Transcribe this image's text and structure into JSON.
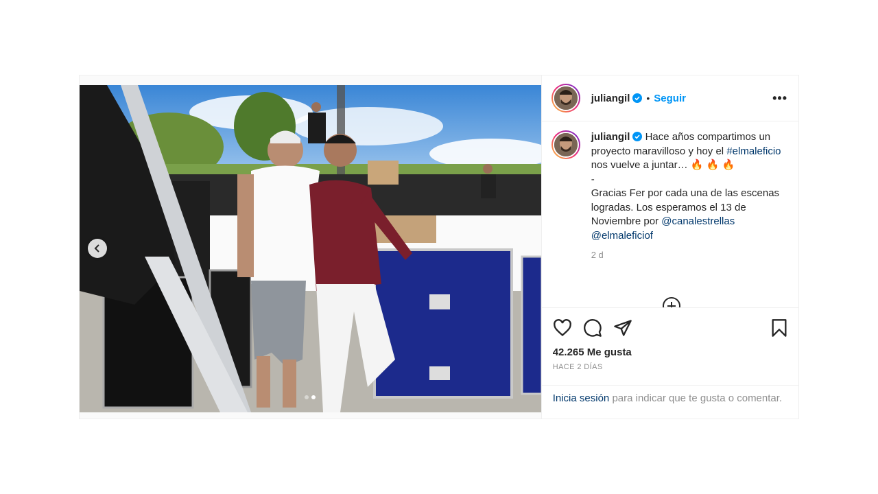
{
  "post": {
    "author": {
      "username": "juliangil",
      "verified": true
    },
    "follow_label": "Seguir",
    "more_label": "•••",
    "caption": {
      "username": "juliangil",
      "text_1": "Hace años compartimos un proyecto maravilloso y hoy el",
      "hashtag": "#elmaleficio",
      "text_2": "nos vuelve a juntar… 🔥 🔥 🔥",
      "dash": "-",
      "text_3": "Gracias Fer por cada una de las escenas logradas. Los esperamos el 13 de Noviembre por",
      "mention_1": "@canalestrellas",
      "mention_2": "@elmaleficiof"
    },
    "time": "2 d",
    "likes": "42.265 Me gusta",
    "posted_ago": "HACE 2 DÍAS",
    "login_prompt": {
      "link": "Inicia sesión",
      "text": "para indicar que te gusta o comentar."
    },
    "carousel": {
      "slides": 2,
      "active": 2
    }
  },
  "colors": {
    "link_blue": "#0095f6",
    "tag_blue": "#00376b",
    "muted": "#8e8e8e",
    "border": "#efefef"
  },
  "icons": [
    "verified-icon",
    "more-icon",
    "heart-icon",
    "comment-icon",
    "share-icon",
    "bookmark-icon",
    "chevron-left-icon",
    "add-comment-icon"
  ]
}
